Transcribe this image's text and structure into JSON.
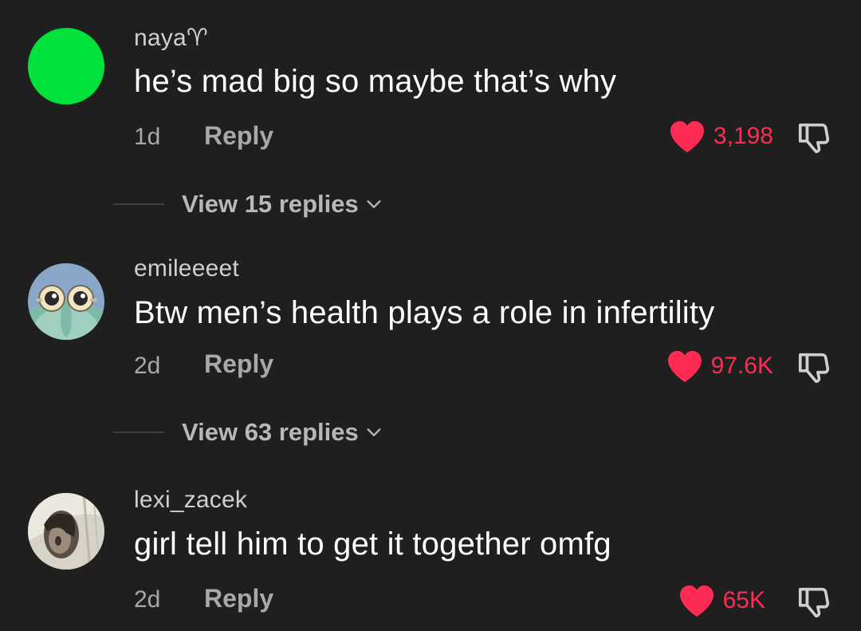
{
  "colors": {
    "background": "#1f1f1f",
    "like_red": "#fe2c55",
    "avatar_green": "#00e13b",
    "muted_text": "#a8a8a8"
  },
  "comments": [
    {
      "username": "naya♈︎",
      "text": "he’s mad big so maybe that’s why",
      "time": "1d",
      "reply_label": "Reply",
      "likes": "3,198",
      "liked": true,
      "view_replies": "View 15 replies",
      "avatar": "green-circle"
    },
    {
      "username": "emileeeet",
      "text": "Btw men’s health plays a role in infertility",
      "time": "2d",
      "reply_label": "Reply",
      "likes": "97.6K",
      "liked": true,
      "view_replies": "View 63 replies",
      "avatar": "cartoon-character"
    },
    {
      "username": "lexi_zacek",
      "text": "girl tell him to get it together omfg",
      "time": "2d",
      "reply_label": "Reply",
      "likes": "65K",
      "liked": true,
      "avatar": "photo"
    }
  ],
  "icons": {
    "like": "heart-icon",
    "dislike": "thumbs-down-icon",
    "expand": "chevron-down-icon"
  }
}
